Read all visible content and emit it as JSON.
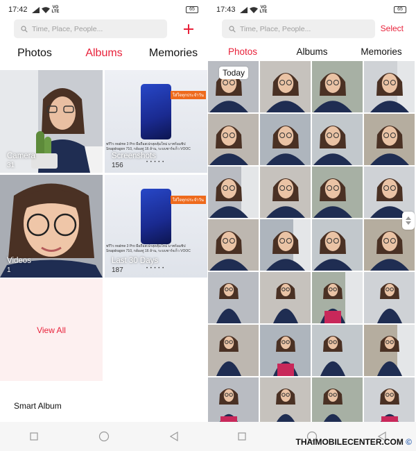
{
  "left": {
    "status": {
      "time": "17:42",
      "volte": "VO\nLTE",
      "battery": "65"
    },
    "search": {
      "placeholder": "Time, Place, People..."
    },
    "add_symbol": "+",
    "tabs": [
      {
        "label": "Photos",
        "active": false
      },
      {
        "label": "Albums",
        "active": true
      },
      {
        "label": "Memories",
        "active": false
      }
    ],
    "albums": [
      {
        "name": "Camera",
        "count": "31"
      },
      {
        "name": "Screenshots",
        "count": "156"
      },
      {
        "name": "Videos",
        "count": "1"
      },
      {
        "name": "Last 30 Days",
        "count": "187"
      }
    ],
    "view_all": "View All",
    "smart_album": "Smart Album"
  },
  "right": {
    "status": {
      "time": "17:43",
      "volte": "VO\nLTE",
      "battery": "65"
    },
    "search": {
      "placeholder": "Time, Place, People..."
    },
    "select": "Select",
    "tabs": [
      {
        "label": "Photos",
        "active": true
      },
      {
        "label": "Albums",
        "active": false
      },
      {
        "label": "Memories",
        "active": false
      }
    ],
    "today": "Today"
  },
  "screenshot_preview": {
    "badge": "ใส่ใจทุกประจำวัน",
    "caption1": "พรีวิว realme 3 Pro มือถือสเปกสุดคุ้มใหม่ มาพร้อมชิป",
    "caption2": "Snapdragon 710, กล้องคู่ 16 ล้าน, ระบบชาร์จเร็ว VOOC",
    "dots": "• • • • •"
  },
  "watermark": "THAIMOBILECENTER.COM",
  "watermark_mark": "©",
  "colors": {
    "accent": "#e8213a",
    "viewall_bg": "#fdf0f0",
    "navbar": "#f6f6f6"
  }
}
